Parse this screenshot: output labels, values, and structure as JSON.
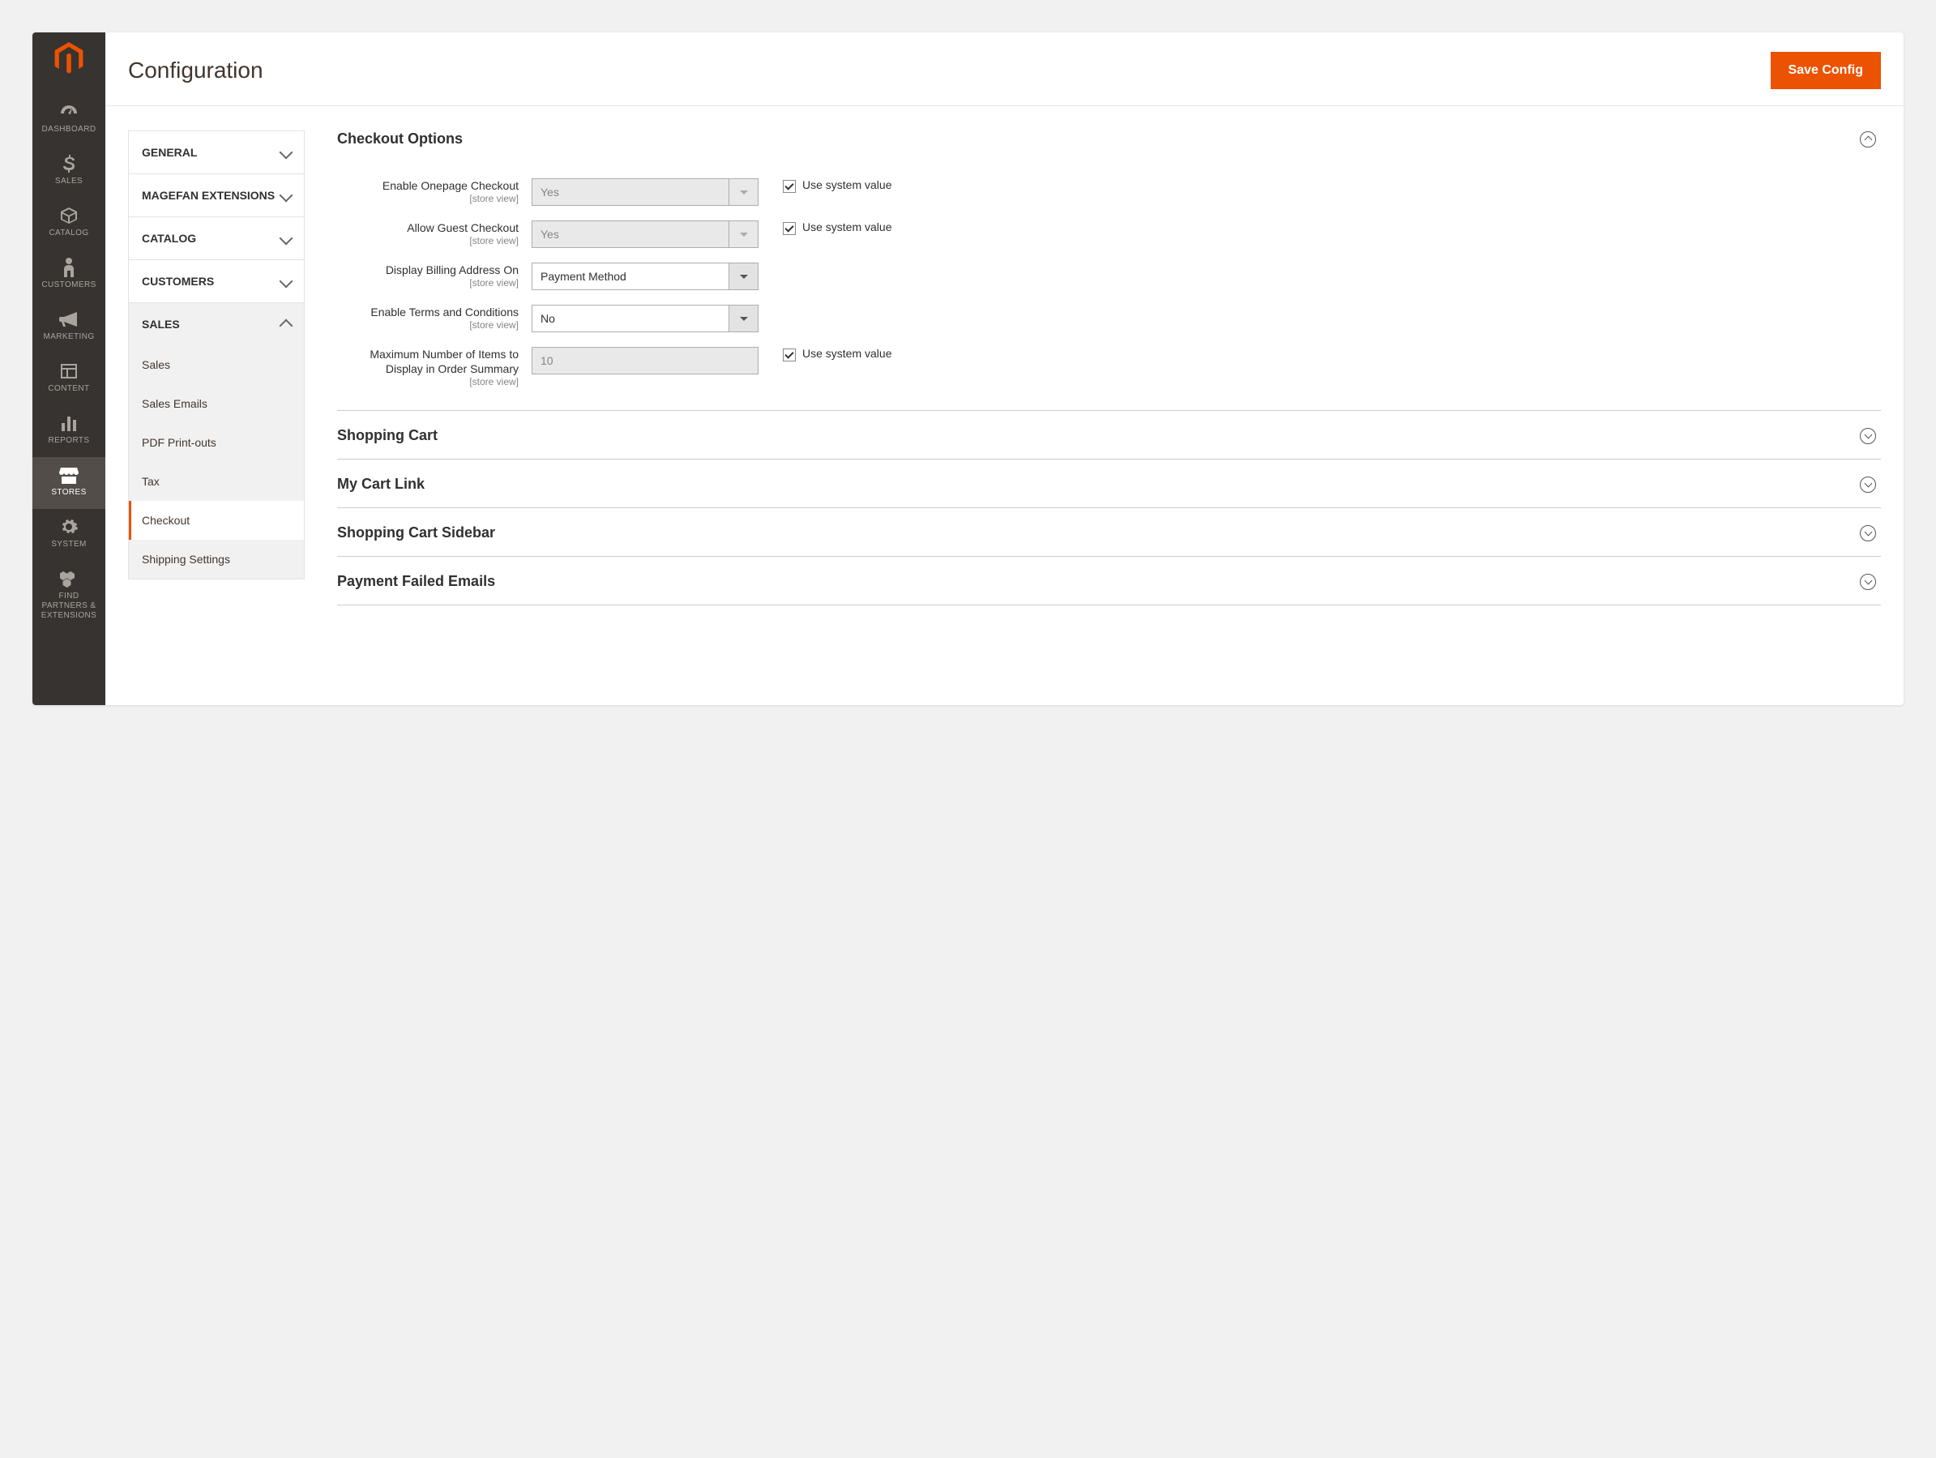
{
  "header": {
    "title": "Configuration",
    "save_label": "Save Config"
  },
  "nav": [
    {
      "id": "dashboard",
      "label": "DASHBOARD",
      "icon": "dashboard"
    },
    {
      "id": "sales",
      "label": "SALES",
      "icon": "dollar"
    },
    {
      "id": "catalog",
      "label": "CATALOG",
      "icon": "box"
    },
    {
      "id": "customers",
      "label": "CUSTOMERS",
      "icon": "person"
    },
    {
      "id": "marketing",
      "label": "MARKETING",
      "icon": "megaphone"
    },
    {
      "id": "content",
      "label": "CONTENT",
      "icon": "layout"
    },
    {
      "id": "reports",
      "label": "REPORTS",
      "icon": "bars"
    },
    {
      "id": "stores",
      "label": "STORES",
      "icon": "storefront",
      "active": true
    },
    {
      "id": "system",
      "label": "SYSTEM",
      "icon": "gear"
    },
    {
      "id": "partners",
      "label": "FIND PARTNERS & EXTENSIONS",
      "icon": "blocks"
    }
  ],
  "config_tabs": [
    {
      "label": "GENERAL"
    },
    {
      "label": "MAGEFAN EXTENSIONS"
    },
    {
      "label": "CATALOG"
    },
    {
      "label": "CUSTOMERS"
    },
    {
      "label": "SALES",
      "expanded": true,
      "items": [
        {
          "label": "Sales"
        },
        {
          "label": "Sales Emails"
        },
        {
          "label": "PDF Print-outs"
        },
        {
          "label": "Tax"
        },
        {
          "label": "Checkout",
          "active": true
        },
        {
          "label": "Shipping Settings"
        }
      ]
    }
  ],
  "sections": {
    "checkout_options": {
      "title": "Checkout Options",
      "expanded": true,
      "fields": [
        {
          "label": "Enable Onepage Checkout",
          "scope": "[store view]",
          "type": "select",
          "value": "Yes",
          "disabled": true,
          "use_system": true
        },
        {
          "label": "Allow Guest Checkout",
          "scope": "[store view]",
          "type": "select",
          "value": "Yes",
          "disabled": true,
          "use_system": true
        },
        {
          "label": "Display Billing Address On",
          "scope": "[store view]",
          "type": "select",
          "value": "Payment Method",
          "disabled": false
        },
        {
          "label": "Enable Terms and Conditions",
          "scope": "[store view]",
          "type": "select",
          "value": "No",
          "disabled": false
        },
        {
          "label": "Maximum Number of Items to Display in Order Summary",
          "scope": "[store view]",
          "type": "text",
          "value": "10",
          "disabled": true,
          "use_system": true
        }
      ]
    },
    "collapsed": [
      {
        "title": "Shopping Cart"
      },
      {
        "title": "My Cart Link"
      },
      {
        "title": "Shopping Cart Sidebar"
      },
      {
        "title": "Payment Failed Emails"
      }
    ],
    "use_system_label": "Use system value"
  }
}
